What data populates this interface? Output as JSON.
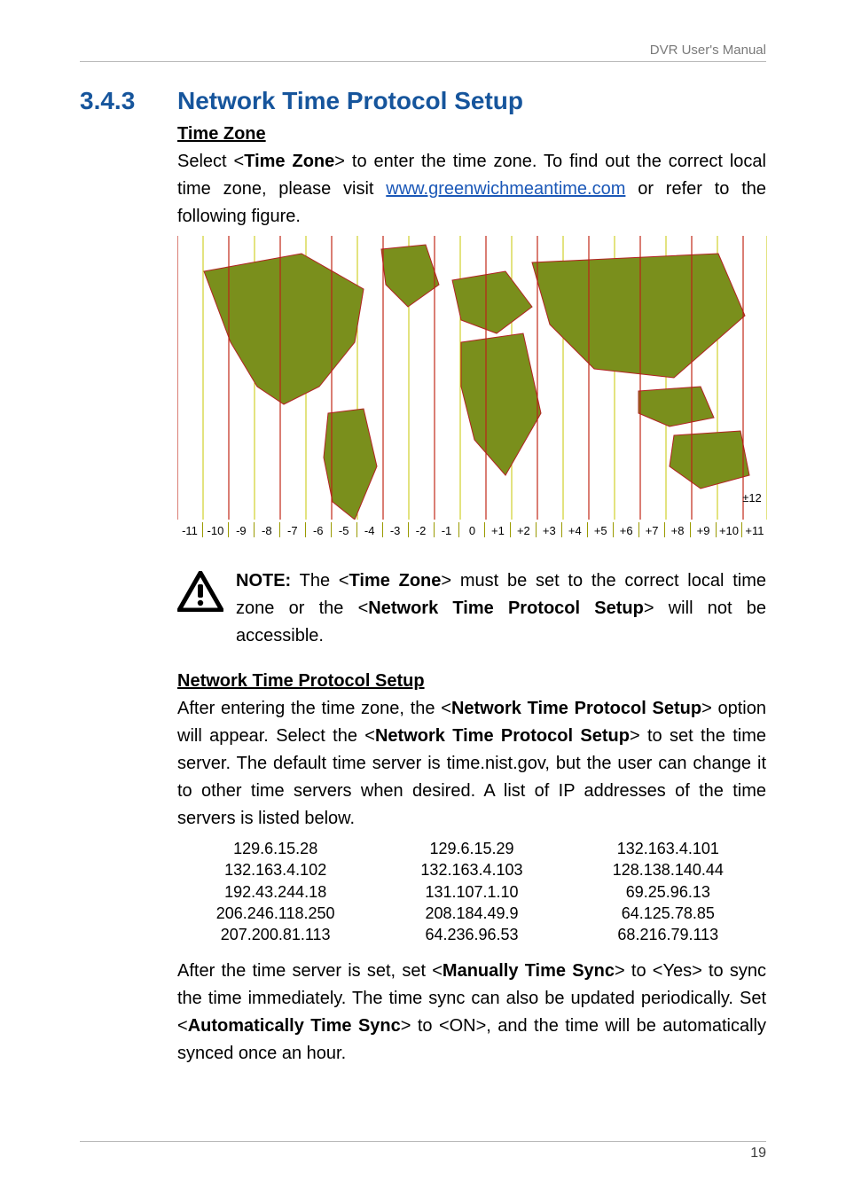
{
  "header": {
    "right": "DVR User's Manual"
  },
  "section": {
    "number": "3.4.3",
    "title": "Network Time Protocol Setup"
  },
  "tz": {
    "heading": "Time Zone",
    "p_pre": "Select <",
    "p_b1": "Time Zone",
    "p_mid1": "> to enter the time zone. To find out the correct local time zone, please visit ",
    "link": "www.greenwichmeantime.com",
    "p_mid2": " or refer to the following figure.",
    "axis": [
      "-11",
      "-10",
      "-9",
      "-8",
      "-7",
      "-6",
      "-5",
      "-4",
      "-3",
      "-2",
      "-1",
      "0",
      "+1",
      "+2",
      "+3",
      "+4",
      "+5",
      "+6",
      "+7",
      "+8",
      "+9",
      "+10",
      "+11"
    ],
    "extra_tick": "±12"
  },
  "note": {
    "pre": "NOTE:",
    "t1": " The <",
    "b1": "Time Zone",
    "t2": "> must be set to the correct local time zone or the <",
    "b2": "Network Time Protocol Setup",
    "t3": "> will not be accessible."
  },
  "ntp": {
    "heading": "Network Time Protocol Setup",
    "p1a": "After entering the time zone, the <",
    "p1b1": "Network Time Protocol Setup",
    "p1b": "> option will appear. Select the <",
    "p1b2": "Network Time Protocol Setup",
    "p1c": "> to set the time server. The default time server is time.nist.gov, but the user can change it to other time servers when desired. A list of IP addresses of the time servers is listed below.",
    "ips_col1": [
      "129.6.15.28",
      "132.163.4.102",
      "192.43.244.18",
      "206.246.118.250",
      "207.200.81.113"
    ],
    "ips_col2": [
      "129.6.15.29",
      "132.163.4.103",
      "131.107.1.10",
      "208.184.49.9",
      "64.236.96.53"
    ],
    "ips_col3": [
      "132.163.4.101",
      "128.138.140.44",
      "69.25.96.13",
      "64.125.78.85",
      "68.216.79.113"
    ],
    "p2a": "After the time server is set, set <",
    "p2b1": "Manually Time Sync",
    "p2b": "> to <Yes> to sync the time immediately. The time sync can also be updated periodically. Set <",
    "p2b2": "Automatically Time Sync",
    "p2c": "> to <ON>, and the time will be automatically synced once an hour."
  },
  "footer": {
    "page": "19"
  }
}
